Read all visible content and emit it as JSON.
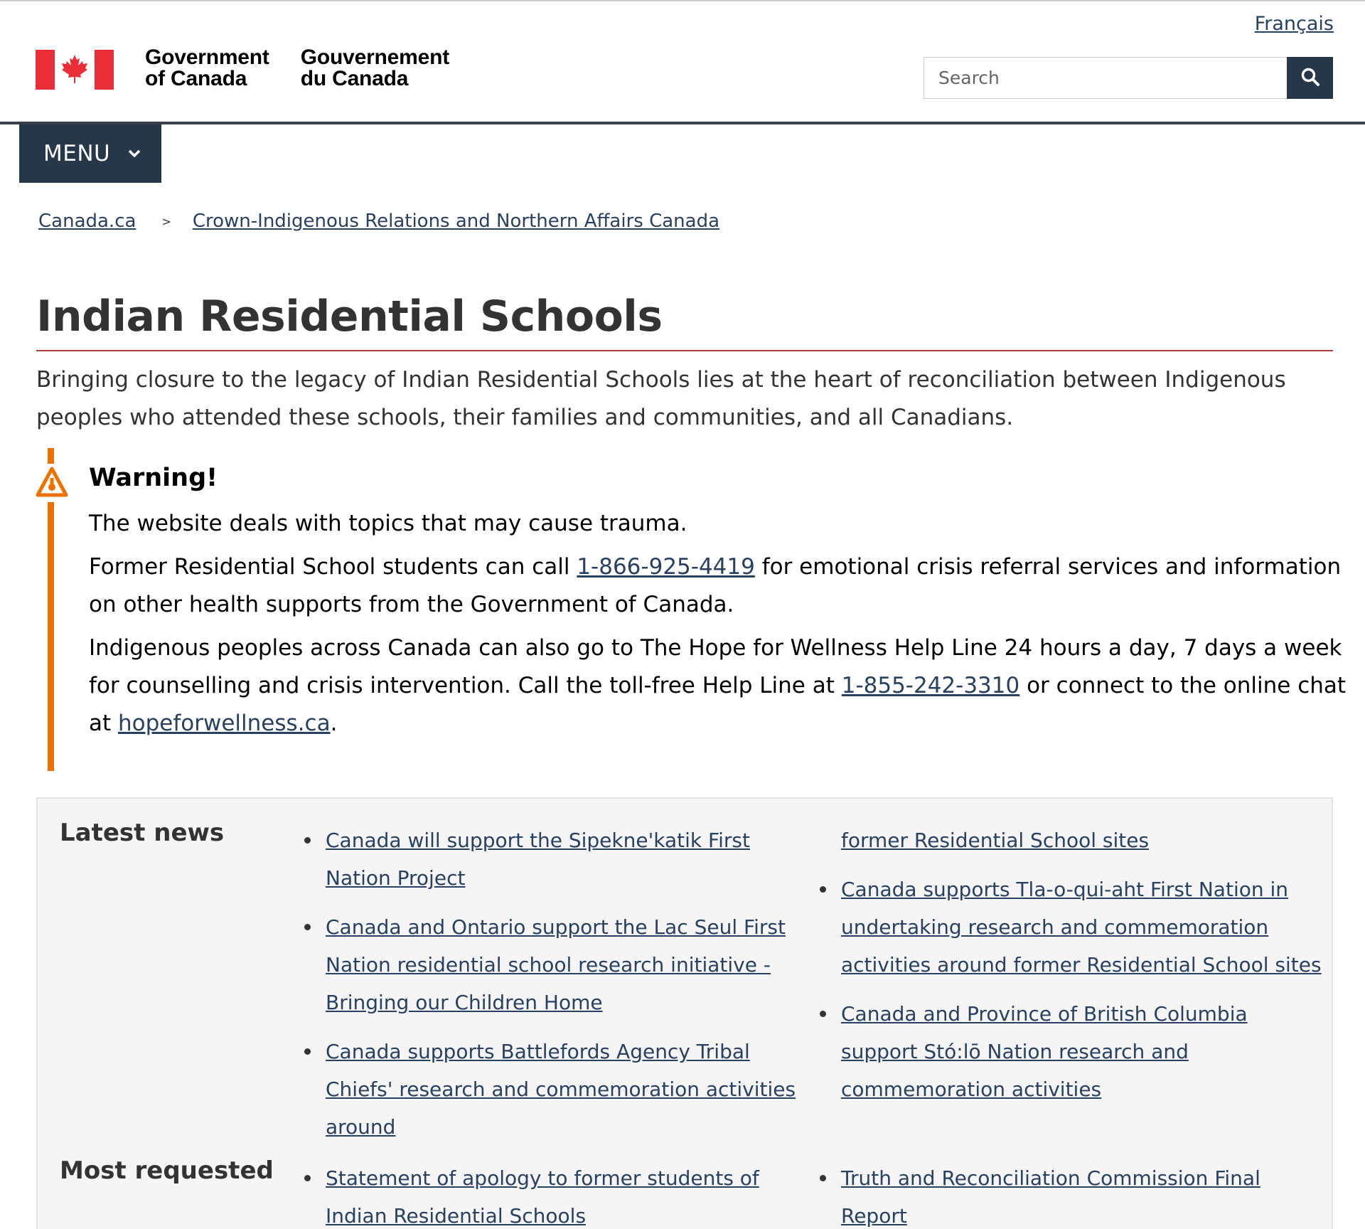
{
  "header": {
    "language_link": "Français",
    "wordmark_en_line1": "Government",
    "wordmark_en_line2": "of Canada",
    "wordmark_fr_line1": "Gouvernement",
    "wordmark_fr_line2": "du Canada",
    "search_placeholder": "Search",
    "menu_label": "MENU",
    "icons": {
      "flag": "canada-flag-icon",
      "search": "search-icon",
      "menu": "chevron-down-icon"
    },
    "colors": {
      "flag_red": "#eb2d37",
      "dark_blue": "#26374a",
      "link": "#284162"
    }
  },
  "breadcrumb": {
    "items": [
      "Canada.ca",
      "Crown-Indigenous Relations and Northern Affairs Canada"
    ],
    "separator": ">"
  },
  "page": {
    "title": "Indian Residential Schools",
    "lead": "Bringing closure to the legacy of Indian Residential Schools lies at the heart of reconciliation between Indigenous peoples who attended these schools, their families and communities, and all Canadians."
  },
  "warning": {
    "heading": "Warning!",
    "icon": "warning-triangle-icon",
    "color": "#ee7100",
    "p1": "The website deals with topics that may cause trauma.",
    "p2_before": "Former Residential School students can call ",
    "p2_link": "1-866-925-4419",
    "p2_after": " for emotional crisis referral services and information on other health supports from the Government of Canada.",
    "p3_before": "Indigenous peoples across Canada can also go to The Hope for Wellness Help Line 24 hours a day, 7 days a week for counselling and crisis intervention. Call the toll-free Help Line at ",
    "p3_link1": "1-855-242-3310",
    "p3_middle": " or connect to the online chat at ",
    "p3_link2": "hopeforwellness.ca",
    "p3_after": "."
  },
  "latest_news": {
    "heading": "Latest news",
    "col1": [
      "Canada will support the Sipekne'katik First Nation Project",
      "Canada and Ontario support the Lac Seul First Nation residential school research initiative - Bringing our Children Home",
      "Canada supports Battlefords Agency Tribal Chiefs' research and commemoration activities around"
    ],
    "col2_continuation": "former Residential School sites",
    "col2": [
      "Canada supports Tla-o-qui-aht First Nation in undertaking research and commemoration activities around former Residential School sites",
      "Canada and Province of British Columbia support Stó:lō Nation research and commemoration activities"
    ]
  },
  "most_requested": {
    "heading": "Most requested",
    "col1": [
      "Statement of apology to former students of Indian Residential Schools"
    ],
    "col2": [
      "Truth and Reconciliation Commission Final Report"
    ]
  }
}
